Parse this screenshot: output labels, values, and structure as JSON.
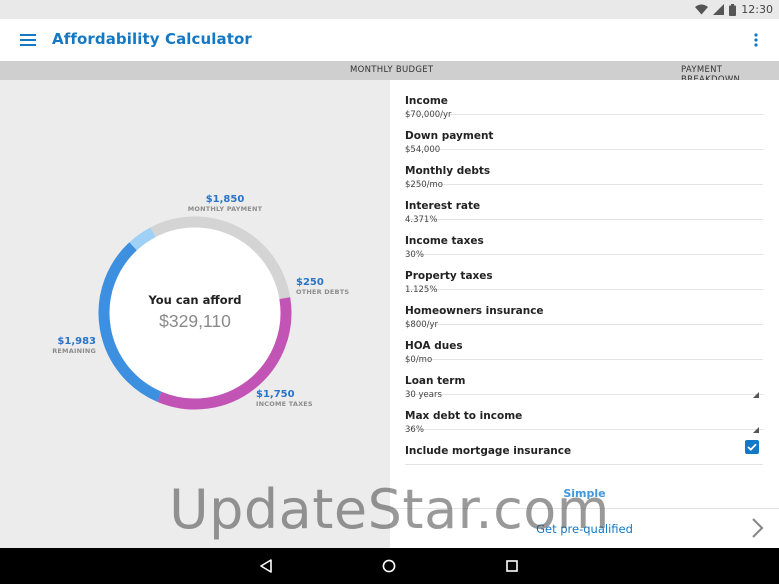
{
  "status_bar": {
    "time": "12:30",
    "icons": [
      "wifi-icon",
      "signal-icon",
      "battery-icon"
    ]
  },
  "app_bar": {
    "title": "Affordability Calculator",
    "menu_icon": "hamburger-menu-icon",
    "overflow_icon": "overflow-menu-icon"
  },
  "tabs": [
    {
      "label": "MONTHLY BUDGET"
    },
    {
      "label": "PAYMENT BREAKDOWN"
    }
  ],
  "summary": {
    "label": "You can afford",
    "value": "$329,110"
  },
  "donut": {
    "colors": {
      "monthly_payment": "#3d8fe0",
      "other_debts": "#9fd0f5",
      "income_taxes": "#d4d4d4",
      "remaining": "#c254b5"
    },
    "segments": [
      {
        "amount": "$1,850",
        "label": "MONTHLY PAYMENT"
      },
      {
        "amount": "$250",
        "label": "OTHER DEBTS"
      },
      {
        "amount": "$1,750",
        "label": "INCOME TAXES"
      },
      {
        "amount": "$1,983",
        "label": "REMAINING"
      }
    ]
  },
  "fields": [
    {
      "label": "Income",
      "value": "$70,000/yr"
    },
    {
      "label": "Down payment",
      "value": "$54,000"
    },
    {
      "label": "Monthly debts",
      "value": "$250/mo"
    },
    {
      "label": "Interest rate",
      "value": "4.371%"
    },
    {
      "label": "Income taxes",
      "value": "30%"
    },
    {
      "label": "Property taxes",
      "value": "1.125%"
    },
    {
      "label": "Homeowners insurance",
      "value": "$800/yr"
    },
    {
      "label": "HOA dues",
      "value": "$0/mo"
    },
    {
      "label": "Loan term",
      "value": "30 years"
    },
    {
      "label": "Max debt to income",
      "value": "36%"
    },
    {
      "label": "Include mortgage insurance",
      "checked": true
    }
  ],
  "actions": {
    "simple_label": "Simple",
    "prequalified_label": "Get pre-qualified"
  },
  "watermark": "UpdateStar.com",
  "nav": {
    "back_icon": "back-icon",
    "home_icon": "home-icon",
    "recents_icon": "recents-icon"
  }
}
